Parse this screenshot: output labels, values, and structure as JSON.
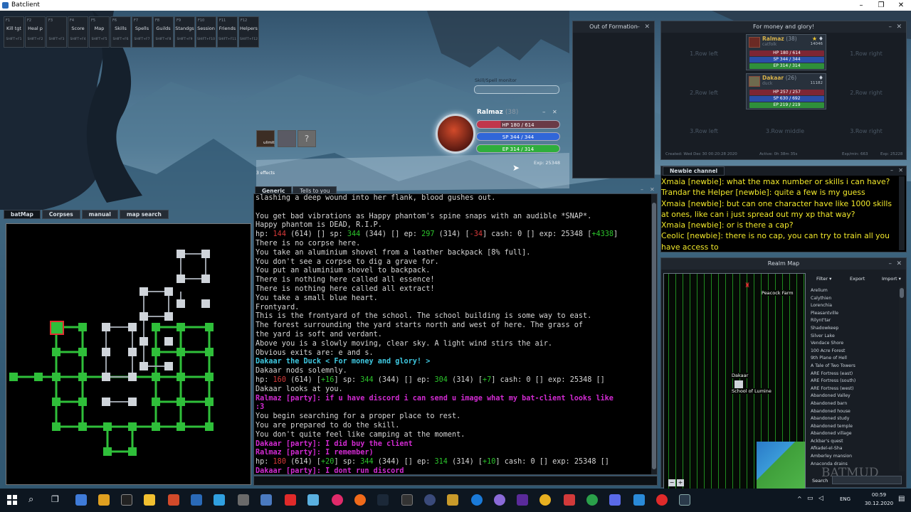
{
  "window": {
    "title": "Batclient",
    "controls": [
      "–",
      "❐",
      "✕"
    ]
  },
  "hotkeys": [
    {
      "fkey": "F1",
      "label": "Kill tgt",
      "shift": "SHIFT+F1"
    },
    {
      "fkey": "F2",
      "label": "Heal p",
      "shift": "SHIFT+F2"
    },
    {
      "fkey": "F3",
      "label": "",
      "shift": "SHIFT+F3"
    },
    {
      "fkey": "F4",
      "label": "Score",
      "shift": "SHIFT+F4"
    },
    {
      "fkey": "F5",
      "label": "Map",
      "shift": "SHIFT+F5"
    },
    {
      "fkey": "F6",
      "label": "Skills",
      "shift": "SHIFT+F6"
    },
    {
      "fkey": "F7",
      "label": "Spells",
      "shift": "SHIFT+F7"
    },
    {
      "fkey": "F8",
      "label": "Guilds",
      "shift": "SHIFT+F8"
    },
    {
      "fkey": "F9",
      "label": "Standgs",
      "shift": "SHIFT+F9"
    },
    {
      "fkey": "F10",
      "label": "Session",
      "shift": "SHIFT+F10"
    },
    {
      "fkey": "F11",
      "label": "Friends",
      "shift": "SHIFT+F11"
    },
    {
      "fkey": "F12",
      "label": "Helpers",
      "shift": "SHIFT+F12"
    }
  ],
  "out_of_formation": {
    "title": "Out of Formation"
  },
  "party": {
    "title": "For money and glory!",
    "slots": [
      "1.Row left",
      "1.Row right",
      "2.Row left",
      "2.Row right",
      "3.Row left",
      "3.Row middle",
      "3.Row right"
    ],
    "members": [
      {
        "name": "Ralmaz",
        "level": "(38)",
        "race": "catfolk",
        "exp": "14046",
        "hp": "HP 180 / 614",
        "sp": "SP 344 / 344",
        "ep": "EP 314 / 314",
        "hp_frac": 0.29,
        "sp_frac": 1.0,
        "ep_frac": 1.0
      },
      {
        "name": "Dakaar",
        "level": "(26)",
        "race": "duck",
        "exp": "11182",
        "hp": "HP 257 / 257",
        "sp": "SP 630 / 692",
        "ep": "EP 219 / 219",
        "hp_frac": 1.0,
        "sp_frac": 0.91,
        "ep_frac": 1.0
      }
    ],
    "stats": {
      "created": "Created: Wed Dec 30 00:20:28 2020",
      "active": "Active: 0h 38m 35s",
      "expmin": "Exp/min: 663",
      "exp": "Exp: 25228"
    }
  },
  "skill_monitor": {
    "label": "Skill/Spell monitor"
  },
  "character": {
    "name": "Ralmaz",
    "level": "(38)",
    "hp": "HP 180 / 614",
    "sp": "SP 344 / 344",
    "ep": "EP 314 / 314",
    "hp_frac": 0.29,
    "sp_frac": 1.0,
    "ep_frac": 1.0,
    "exp": "Exp: 25348"
  },
  "effects": {
    "first_label": "ulimit",
    "count": "3 effects"
  },
  "left_tabs": [
    "batMap",
    "Corpses",
    "manual",
    "map search"
  ],
  "console_tabs": [
    "Generic",
    "Tells to you"
  ],
  "console": {
    "lines": [
      [
        {
          "t": "slashing a deep wound into her flank, blood gushes out.",
          "c": "def"
        }
      ],
      [
        {
          "t": "",
          "c": "def"
        }
      ],
      [
        {
          "t": "You get bad vibrations as Happy phantom's spine snaps with an audible *SNAP*.",
          "c": "def"
        }
      ],
      [
        {
          "t": "Happy phantom is DEAD, R.I.P.",
          "c": "def"
        }
      ],
      [
        {
          "t": "hp: ",
          "c": "def"
        },
        {
          "t": "144",
          "c": "r"
        },
        {
          "t": " (614) [] sp: ",
          "c": "def"
        },
        {
          "t": "344",
          "c": "g"
        },
        {
          "t": " (344) [] ep: ",
          "c": "def"
        },
        {
          "t": "297",
          "c": "g"
        },
        {
          "t": " (314) [",
          "c": "def"
        },
        {
          "t": "-34",
          "c": "r"
        },
        {
          "t": "] cash: 0 [] exp: 25348 [",
          "c": "def"
        },
        {
          "t": "+4338",
          "c": "g"
        },
        {
          "t": "]",
          "c": "def"
        }
      ],
      [
        {
          "t": "There is no corpse here.",
          "c": "def"
        }
      ],
      [
        {
          "t": "You take an aluminium shovel from a leather backpack [8% full].",
          "c": "def"
        }
      ],
      [
        {
          "t": "You don't see a corpse to dig a grave for.",
          "c": "def"
        }
      ],
      [
        {
          "t": "You put an aluminium shovel to backpack.",
          "c": "def"
        }
      ],
      [
        {
          "t": "There is nothing here called all essence!",
          "c": "def"
        }
      ],
      [
        {
          "t": "There is nothing here called all extract!",
          "c": "def"
        }
      ],
      [
        {
          "t": "You take a small blue heart.",
          "c": "def"
        }
      ],
      [
        {
          "t": "Frontyard.",
          "c": "def"
        }
      ],
      [
        {
          "t": "This is the frontyard of the school. The school building is some way to east.",
          "c": "def"
        }
      ],
      [
        {
          "t": "The forest surrounding the yard starts north and west of here. The grass of",
          "c": "def"
        }
      ],
      [
        {
          "t": "the yard is soft and verdant.",
          "c": "def"
        }
      ],
      [
        {
          "t": "Above you is a slowly moving, clear sky. A light wind stirs the air.",
          "c": "def"
        }
      ],
      [
        {
          "t": "Obvious exits are: e and s.",
          "c": "def"
        }
      ],
      [
        {
          "t": "Dakaar the Duck < For money and glory! >",
          "c": "cy"
        }
      ],
      [
        {
          "t": "Dakaar nods solemnly.",
          "c": "def"
        }
      ],
      [
        {
          "t": "hp: ",
          "c": "def"
        },
        {
          "t": "160",
          "c": "r"
        },
        {
          "t": " (614) [",
          "c": "def"
        },
        {
          "t": "+16",
          "c": "g"
        },
        {
          "t": "] sp: ",
          "c": "def"
        },
        {
          "t": "344",
          "c": "g"
        },
        {
          "t": " (344) [] ep: ",
          "c": "def"
        },
        {
          "t": "304",
          "c": "g"
        },
        {
          "t": " (314) [",
          "c": "def"
        },
        {
          "t": "+7",
          "c": "g"
        },
        {
          "t": "] cash: 0 [] exp: 25348 []",
          "c": "def"
        }
      ],
      [
        {
          "t": "Dakaar looks at you.",
          "c": "def"
        }
      ],
      [
        {
          "t": "Ralmaz [party]: if u have discord i can send u image what my bat-client looks like",
          "c": "mg"
        }
      ],
      [
        {
          "t": ":3",
          "c": "mg"
        }
      ],
      [
        {
          "t": "You begin searching for a proper place to rest.",
          "c": "def"
        }
      ],
      [
        {
          "t": "You are prepared to do the skill.",
          "c": "def"
        }
      ],
      [
        {
          "t": "You don't quite feel like camping at the moment.",
          "c": "def"
        }
      ],
      [
        {
          "t": "Dakaar [party]: I did buy the client",
          "c": "mg"
        }
      ],
      [
        {
          "t": "Ralmaz [party]: I remember)",
          "c": "mg"
        }
      ],
      [
        {
          "t": "hp: ",
          "c": "def"
        },
        {
          "t": "180",
          "c": "r"
        },
        {
          "t": " (614) [",
          "c": "def"
        },
        {
          "t": "+20",
          "c": "g"
        },
        {
          "t": "] sp: ",
          "c": "def"
        },
        {
          "t": "344",
          "c": "g"
        },
        {
          "t": " (344) [] ep: ",
          "c": "def"
        },
        {
          "t": "314",
          "c": "g"
        },
        {
          "t": " (314) [",
          "c": "def"
        },
        {
          "t": "+10",
          "c": "g"
        },
        {
          "t": "] cash: 0 [] exp: 25348 []",
          "c": "def"
        }
      ],
      [
        {
          "t": "Dakaar [party]: I dont run discord",
          "c": "mg"
        }
      ]
    ]
  },
  "newbie_channel": {
    "title": "Newbie channel",
    "messages": [
      "Xmaia [newbie]: what the max number or skills i can have?",
      "Trandar the Helper [newbie]: quite a few is my guess",
      "Xmaia [newbie]: but can one character have like 1000 skills at ones, like can i just spread out my xp that way?",
      "Xmaia [newbie]: or is there a cap?",
      "Ceolic [newbie]: there is no cap, you can try to train all you have access to"
    ]
  },
  "realm_map": {
    "title": "Realm Map",
    "filter": "Filter",
    "export": "Export",
    "import": "Import",
    "search_label": "Search",
    "map_labels": {
      "farm": "Peacock Farm",
      "player": "Dakaar",
      "school": "School of Lumine"
    },
    "watermark": "BATMUD",
    "places": [
      "Arelium",
      "Calythien",
      "Lorenchia",
      "Pleasantville",
      "Rilynt'tar",
      "Shadowkeep",
      "Silver Lake",
      "Vendace Shore",
      "100 Acre Forest",
      "9th Plane of Hell",
      "A Tale of Two Towers",
      "ARE Fortress (east)",
      "ARE Fortress (south)",
      "ARE Fortress (west)",
      "Abandoned Valley",
      "Abandoned barn",
      "Abandoned house",
      "Abandoned study",
      "Abandoned temple",
      "Abandoned village",
      "Ackbar's quest",
      "Afkadel-el-Sha",
      "Amberley mansion",
      "Anaconda drains"
    ]
  },
  "taskbar": {
    "language": "ENG",
    "time": "00:59",
    "date": "30.12.2020"
  }
}
